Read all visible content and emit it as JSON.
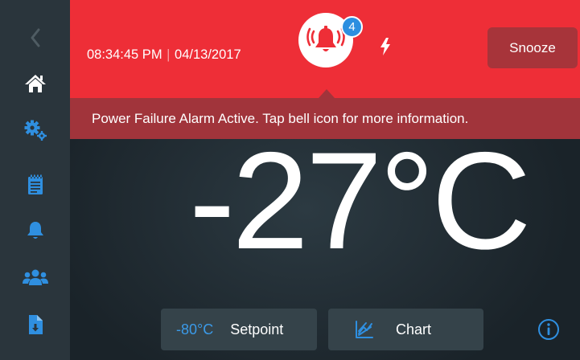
{
  "header": {
    "time": "08:34:45 PM",
    "separator": "|",
    "date": "04/13/2017",
    "alarm_count": "4",
    "snooze_label": "Snooze"
  },
  "banner": {
    "message": "Power Failure Alarm Active. Tap bell icon for more information."
  },
  "main": {
    "temperature": "-27°C"
  },
  "bottom": {
    "setpoint_value": "-80°C",
    "setpoint_label": "Setpoint",
    "chart_label": "Chart"
  },
  "icons": {
    "sidebar": [
      "back-icon",
      "home-icon",
      "settings-gears-icon",
      "notepad-icon",
      "bell-icon",
      "users-icon",
      "download-file-icon"
    ],
    "header": [
      "alarm-bell-icon",
      "power-failure-icon"
    ],
    "bottom": [
      "chart-icon",
      "info-icon"
    ]
  },
  "colors": {
    "alarm_red": "#ee2e37",
    "banner_red": "#a1343b",
    "snooze_bg": "#a7343a",
    "sidebar_bg": "#2a353c",
    "accent_blue": "#2d8fe0",
    "button_bg": "#35434a"
  }
}
